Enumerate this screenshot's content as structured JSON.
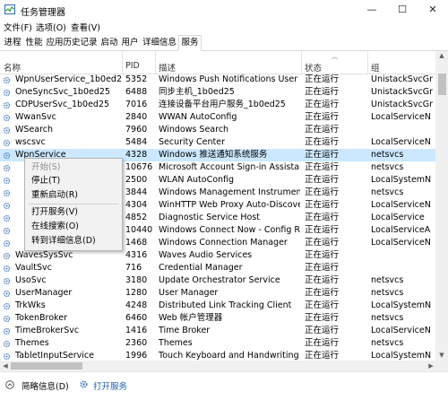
{
  "window": {
    "title": "任务管理器",
    "minimize_icon": "—",
    "maximize_icon": "☐",
    "close_icon": "✕"
  },
  "menu": [
    "文件(F)",
    "选项(O)",
    "查看(V)"
  ],
  "tabs": [
    "进程",
    "性能",
    "应用历史记录",
    "启动",
    "用户",
    "详细信息",
    "服务"
  ],
  "active_tab": "服务",
  "columns": {
    "name": "名称",
    "pid": "PID",
    "desc": "描述",
    "status": "状态",
    "group": "组"
  },
  "rows": [
    {
      "name": "WpnUserService_1b0ed25",
      "pid": "5352",
      "desc": "Windows Push Notifications User S...",
      "status": "正在运行",
      "group": "UnistackSvcGr"
    },
    {
      "name": "OneSyncSvc_1b0ed25",
      "pid": "6488",
      "desc": "同步主机_1b0ed25",
      "status": "正在运行",
      "group": "UnistackSvcGr"
    },
    {
      "name": "CDPUserSvc_1b0ed25",
      "pid": "7016",
      "desc": "连接设备平台用户服务_1b0ed25",
      "status": "正在运行",
      "group": "UnistackSvcGr"
    },
    {
      "name": "WwanSvc",
      "pid": "2840",
      "desc": "WWAN AutoConfig",
      "status": "正在运行",
      "group": "LocalServiceN"
    },
    {
      "name": "WSearch",
      "pid": "7960",
      "desc": "Windows Search",
      "status": "正在运行",
      "group": ""
    },
    {
      "name": "wscsvc",
      "pid": "5484",
      "desc": "Security Center",
      "status": "正在运行",
      "group": "LocalServiceN"
    },
    {
      "name": "WpnService",
      "pid": "4328",
      "desc": "Windows 推送通知系统服务",
      "status": "正在运行",
      "group": "netsvcs"
    },
    {
      "name": "",
      "pid": "10676",
      "desc": "Microsoft Account Sign-in Assistant",
      "status": "正在运行",
      "group": "netsvcs"
    },
    {
      "name": "",
      "pid": "2500",
      "desc": "WLAN AutoConfig",
      "status": "正在运行",
      "group": "LocalSystemN"
    },
    {
      "name": "",
      "pid": "3844",
      "desc": "Windows Management Instrument...",
      "status": "正在运行",
      "group": "netsvcs"
    },
    {
      "name": "",
      "pid": "4304",
      "desc": "WinHTTP Web Proxy Auto-Discove...",
      "status": "正在运行",
      "group": "LocalServiceN"
    },
    {
      "name": "",
      "pid": "4852",
      "desc": "Diagnostic Service Host",
      "status": "正在运行",
      "group": "LocalService"
    },
    {
      "name": "",
      "pid": "10440",
      "desc": "Windows Connect Now - Config R...",
      "status": "正在运行",
      "group": "LocalServiceA"
    },
    {
      "name": "",
      "pid": "1468",
      "desc": "Windows Connection Manager",
      "status": "正在运行",
      "group": "LocalServiceN"
    },
    {
      "name": "WavesSysSvc",
      "pid": "4316",
      "desc": "Waves Audio Services",
      "status": "正在运行",
      "group": ""
    },
    {
      "name": "VaultSvc",
      "pid": "716",
      "desc": "Credential Manager",
      "status": "正在运行",
      "group": ""
    },
    {
      "name": "UsoSvc",
      "pid": "3180",
      "desc": "Update Orchestrator Service",
      "status": "正在运行",
      "group": "netsvcs"
    },
    {
      "name": "UserManager",
      "pid": "1280",
      "desc": "User Manager",
      "status": "正在运行",
      "group": "netsvcs"
    },
    {
      "name": "TrkWks",
      "pid": "4248",
      "desc": "Distributed Link Tracking Client",
      "status": "正在运行",
      "group": "LocalSystemN"
    },
    {
      "name": "TokenBroker",
      "pid": "6460",
      "desc": "Web 帐户管理器",
      "status": "正在运行",
      "group": "netsvcs"
    },
    {
      "name": "TimeBrokerSvc",
      "pid": "1416",
      "desc": "Time Broker",
      "status": "正在运行",
      "group": "LocalServiceN"
    },
    {
      "name": "Themes",
      "pid": "2360",
      "desc": "Themes",
      "status": "正在运行",
      "group": "netsvcs"
    },
    {
      "name": "TabletInputService",
      "pid": "1996",
      "desc": "Touch Keyboard and Handwriting ...",
      "status": "正在运行",
      "group": "LocalSystemN"
    }
  ],
  "selected_row": 6,
  "context_menu": {
    "start": "开始(S)",
    "stop": "停止(T)",
    "restart": "重新启动(R)",
    "open_services": "打开服务(V)",
    "search_online": "在线搜索(O)",
    "go_to_details": "转到详细信息(D)"
  },
  "footer": {
    "fewer_details": "简略信息(D)",
    "open_services": "打开服务"
  },
  "colors": {
    "selection": "#cce8ff",
    "link": "#1a5fb4"
  }
}
